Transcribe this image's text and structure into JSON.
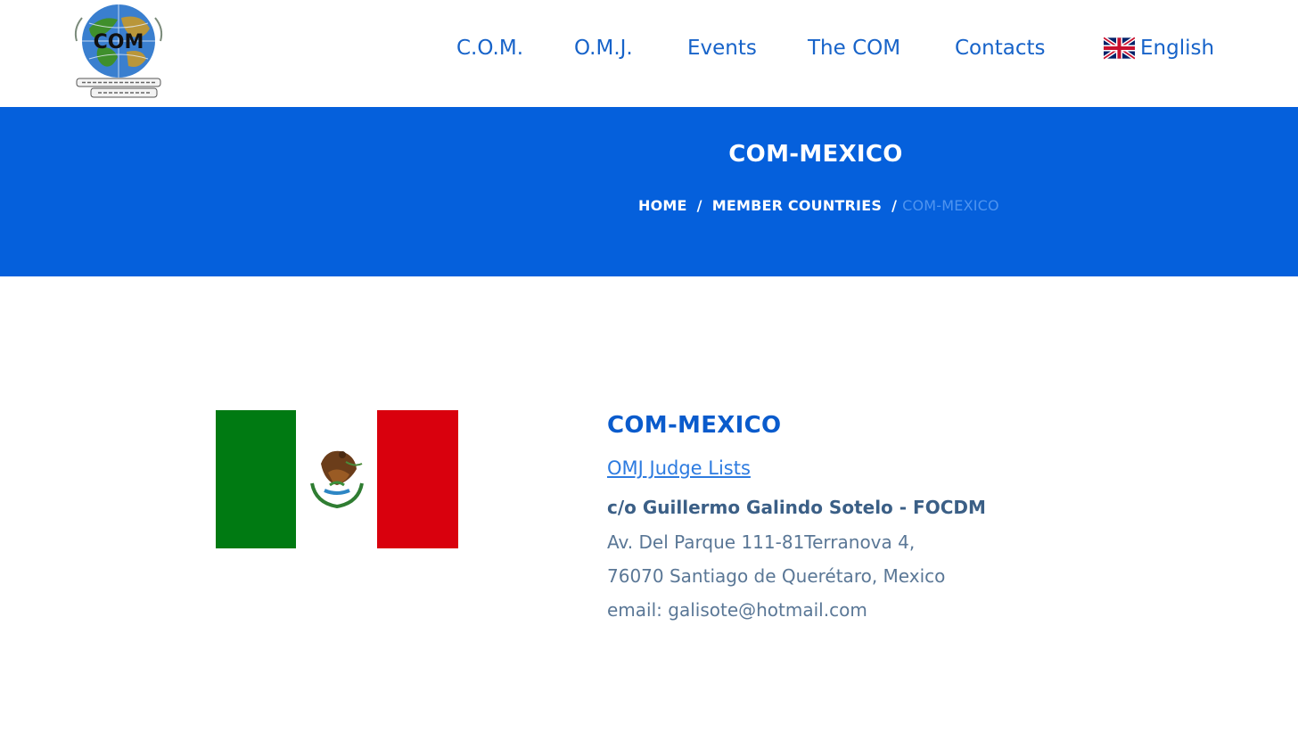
{
  "nav": {
    "items": [
      "C.O.M.",
      "O.M.J.",
      "Events",
      "The COM",
      "Contacts"
    ],
    "language": "English"
  },
  "banner": {
    "title": "COM-MEXICO",
    "breadcrumb": {
      "home": "HOME",
      "parent": "MEMBER COUNTRIES",
      "current": "COM-MEXICO",
      "separator": "/"
    }
  },
  "country": {
    "title": "COM-MEXICO",
    "judge_link": "OMJ Judge Lists",
    "contact_name": "c/o Guillermo Galindo Sotelo - FOCDM",
    "address_line1": "Av. Del Parque 111-81Terranova 4,",
    "address_line2": "76070 Santiago de Querétaro, Mexico",
    "email_line": "email: galisote@hotmail.com"
  },
  "colors": {
    "nav_text": "#1763c9",
    "banner_bg": "#0560dc",
    "breadcrumb_current": "#4f94ef",
    "title_blue": "#0a5bcc",
    "flag_green": "#007a12",
    "flag_red": "#d9000d"
  },
  "icons": {
    "logo": "globe-logo-icon",
    "language_flag": "uk-flag-icon",
    "country_flag": "mexico-flag-icon"
  }
}
